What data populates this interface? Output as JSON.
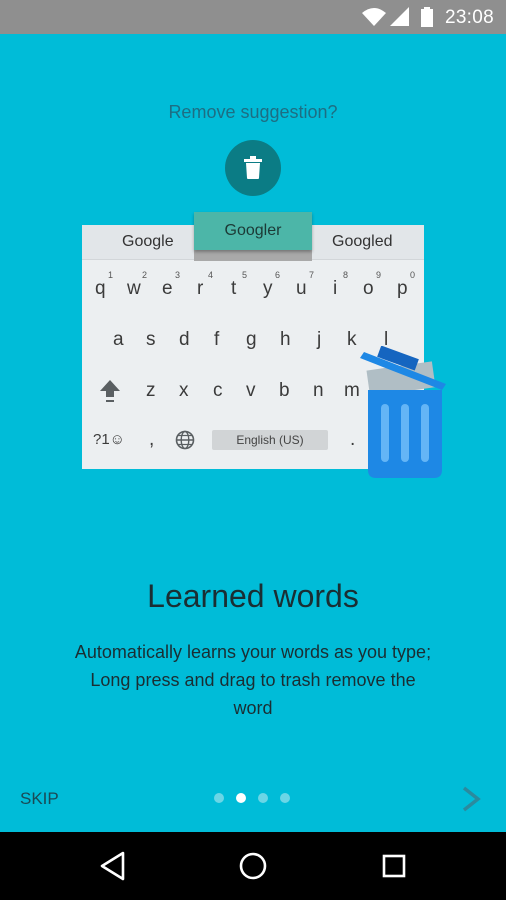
{
  "status_bar": {
    "time": "23:08",
    "icons": [
      "wifi-icon",
      "signal-icon",
      "battery-icon"
    ]
  },
  "dialog": {
    "title": "Remove suggestion?",
    "icon": "trash-icon"
  },
  "keyboard": {
    "suggestions": [
      "Google",
      "Googler",
      "Googled"
    ],
    "row1": [
      "q",
      "w",
      "e",
      "r",
      "t",
      "y",
      "u",
      "i",
      "o",
      "p"
    ],
    "row1_hints": [
      "1",
      "2",
      "3",
      "4",
      "5",
      "6",
      "7",
      "8",
      "9",
      "0"
    ],
    "row2": [
      "a",
      "s",
      "d",
      "f",
      "g",
      "h",
      "j",
      "k",
      "l"
    ],
    "row3": [
      "z",
      "x",
      "c",
      "v",
      "b",
      "n",
      "m"
    ],
    "symbols_key": "?1☺",
    "comma_key": ",",
    "period_key": ".",
    "space_label": "English (US)",
    "icons": [
      "shift-icon",
      "globe-icon"
    ]
  },
  "content": {
    "headline": "Learned words",
    "description_lines": [
      "Automatically learns your words as you type;",
      "Long press and drag to trash remove the",
      "word"
    ]
  },
  "footer": {
    "skip_label": "SKIP",
    "page_count": 4,
    "current_page": 2,
    "next_icon": "chevron-right-icon"
  },
  "nav_bar": {
    "icons": [
      "back-icon",
      "home-icon",
      "recents-icon"
    ]
  },
  "colors": {
    "background": "#00BCD8",
    "status_bar": "#8F8F8F",
    "trash_circle": "#0B7C85",
    "suggestion_popup": "#4CB6A8",
    "trash_blue": "#1E88E5"
  }
}
